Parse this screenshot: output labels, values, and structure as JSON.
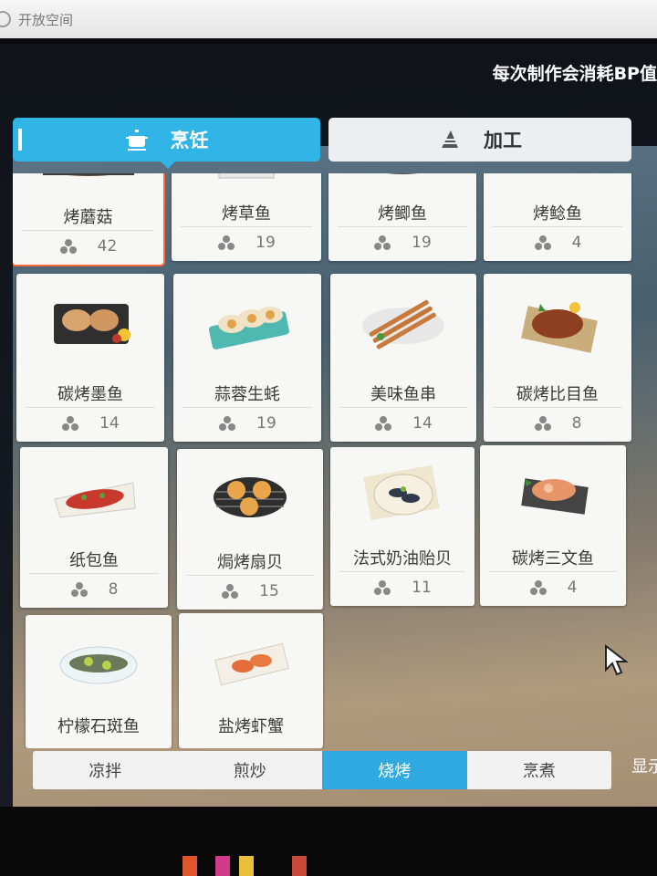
{
  "window": {
    "title": "开放空间"
  },
  "header": {
    "hint": "每次制作会消耗BP值"
  },
  "tabs": [
    {
      "label": "烹饪",
      "icon": "cooking-pot-icon",
      "active": true
    },
    {
      "label": "加工",
      "icon": "processing-icon",
      "active": false
    }
  ],
  "recipes": [
    {
      "name": "烤蘑菇",
      "cost": "42",
      "selected": true
    },
    {
      "name": "烤草鱼",
      "cost": "19"
    },
    {
      "name": "烤鲫鱼",
      "cost": "19"
    },
    {
      "name": "烤鲶鱼",
      "cost": "4"
    },
    {
      "name": "碳烤墨鱼",
      "cost": "14"
    },
    {
      "name": "蒜蓉生蚝",
      "cost": "19"
    },
    {
      "name": "美味鱼串",
      "cost": "14"
    },
    {
      "name": "碳烤比目鱼",
      "cost": "8"
    },
    {
      "name": "纸包鱼",
      "cost": "8"
    },
    {
      "name": "焗烤扇贝",
      "cost": "15"
    },
    {
      "name": "法式奶油贻贝",
      "cost": "11"
    },
    {
      "name": "碳烤三文鱼",
      "cost": "4"
    },
    {
      "name": "柠檬石斑鱼",
      "cost": ""
    },
    {
      "name": "盐烤虾蟹",
      "cost": ""
    }
  ],
  "categories": [
    {
      "label": "凉拌",
      "active": false
    },
    {
      "label": "煎炒",
      "active": false
    },
    {
      "label": "烧烤",
      "active": true
    },
    {
      "label": "烹煮",
      "active": false
    }
  ],
  "side_label": "显示",
  "colors": {
    "accent": "#31b5e6",
    "selected_border": "#ff6a3d"
  }
}
